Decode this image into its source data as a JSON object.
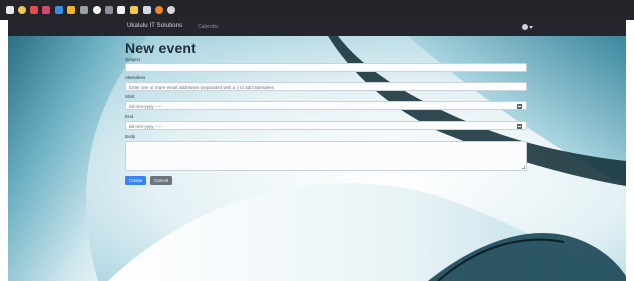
{
  "taskbar": {
    "icons": [
      {
        "name": "grid-icon",
        "color": "#e8e8ec"
      },
      {
        "name": "chrome-icon",
        "color": "#f2c94c"
      },
      {
        "name": "record-icon",
        "color": "#e04b4b"
      },
      {
        "name": "mail-icon",
        "color": "#d6486b"
      },
      {
        "name": "edge-icon",
        "color": "#3a8ee6"
      },
      {
        "name": "check-icon",
        "color": "#f0b429"
      },
      {
        "name": "gear-icon",
        "color": "#9aa0a6"
      },
      {
        "name": "github-icon",
        "color": "#f5f5f5"
      },
      {
        "name": "slash-icon",
        "color": "#8a8f99"
      },
      {
        "name": "document-icon",
        "color": "#f2f2f2"
      },
      {
        "name": "folder-icon",
        "color": "#f2c94c"
      },
      {
        "name": "download-icon",
        "color": "#cfd8e3"
      },
      {
        "name": "firefox-icon",
        "color": "#f08a24"
      },
      {
        "name": "settings-icon",
        "color": "#d8d8d8"
      }
    ]
  },
  "navbar": {
    "brand": "Ukalulu IT Solutions",
    "link": "Calendar"
  },
  "form": {
    "title": "New event",
    "subject_label": "Subject",
    "subject_value": "",
    "attendees_label": "Attendees",
    "attendees_placeholder": "Enter one or more email addresses (separated with a ;) to add attendees",
    "start_label": "Start",
    "start_value": "dd-mm-yyyy --:--",
    "end_label": "End",
    "end_value": "dd-mm-yyyy --:--",
    "body_label": "Body",
    "create_label": "Create",
    "cancel_label": "Cancel"
  },
  "colors": {
    "background": "#c8e3ec",
    "accent": "#3b82f6",
    "navbar": "#25252d"
  }
}
